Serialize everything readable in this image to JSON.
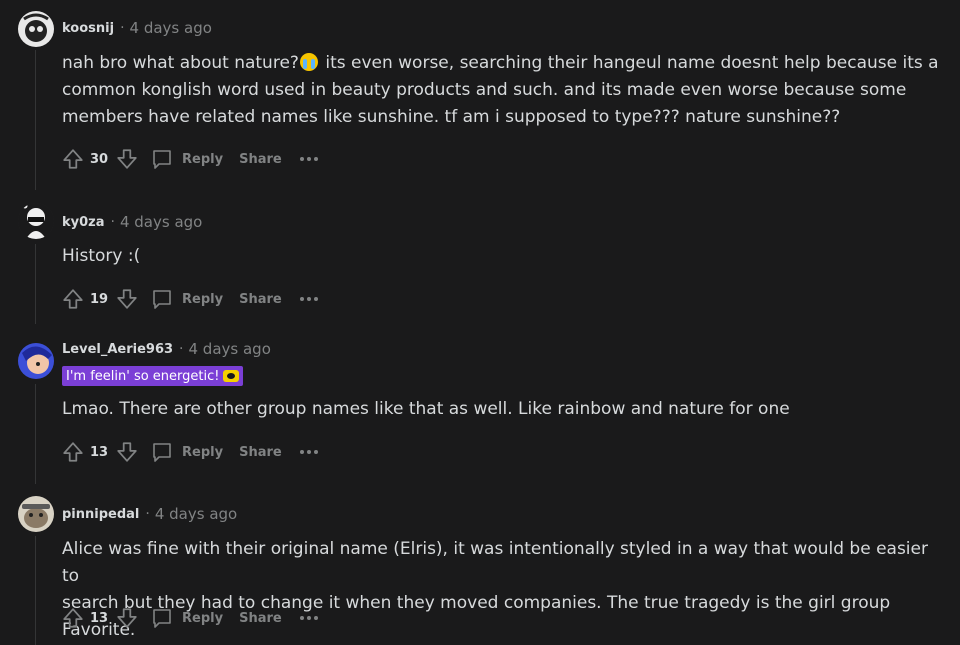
{
  "comments": [
    {
      "username": "koosnij",
      "time": "4 days ago",
      "body_lines": [
        "nah bro what about nature?",
        " its even worse, searching their hangeul name doesnt help because its a",
        "common konglish word used in beauty products and such. and its made even worse because some",
        "members have related names like sunshine. tf am i supposed to type??? nature sunshine??"
      ],
      "score": "30",
      "reply": "Reply",
      "share": "Share"
    },
    {
      "username": "ky0za",
      "time": "4 days ago",
      "body": "History :(",
      "score": "19",
      "reply": "Reply",
      "share": "Share"
    },
    {
      "username": "Level_Aerie963",
      "time": "4 days ago",
      "flair": "I'm feelin' so energetic!",
      "body": "Lmao. There are other group names like that as well. Like rainbow and nature for one",
      "score": "13",
      "reply": "Reply",
      "share": "Share"
    },
    {
      "username": "pinnipedal",
      "time": "4 days ago",
      "body_lines": [
        "Alice was fine with their original name (Elris), it was intentionally styled in a way that would be easier to",
        "search but they had to change it when they moved companies. The true tragedy is the girl group Favorite."
      ],
      "score": "13",
      "reply": "Reply",
      "share": "Share"
    }
  ],
  "separator": "·",
  "icons": {
    "upvote": "arrow-up-outline-icon",
    "downvote": "arrow-down-outline-icon",
    "reply": "speech-bubble-icon",
    "more": "ellipsis-icon",
    "emoji": "loudly-crying-face-icon"
  },
  "colors": {
    "background": "#1a1a1b",
    "text": "#d7dadc",
    "muted": "#818384",
    "flair": "#7b3fd6"
  }
}
